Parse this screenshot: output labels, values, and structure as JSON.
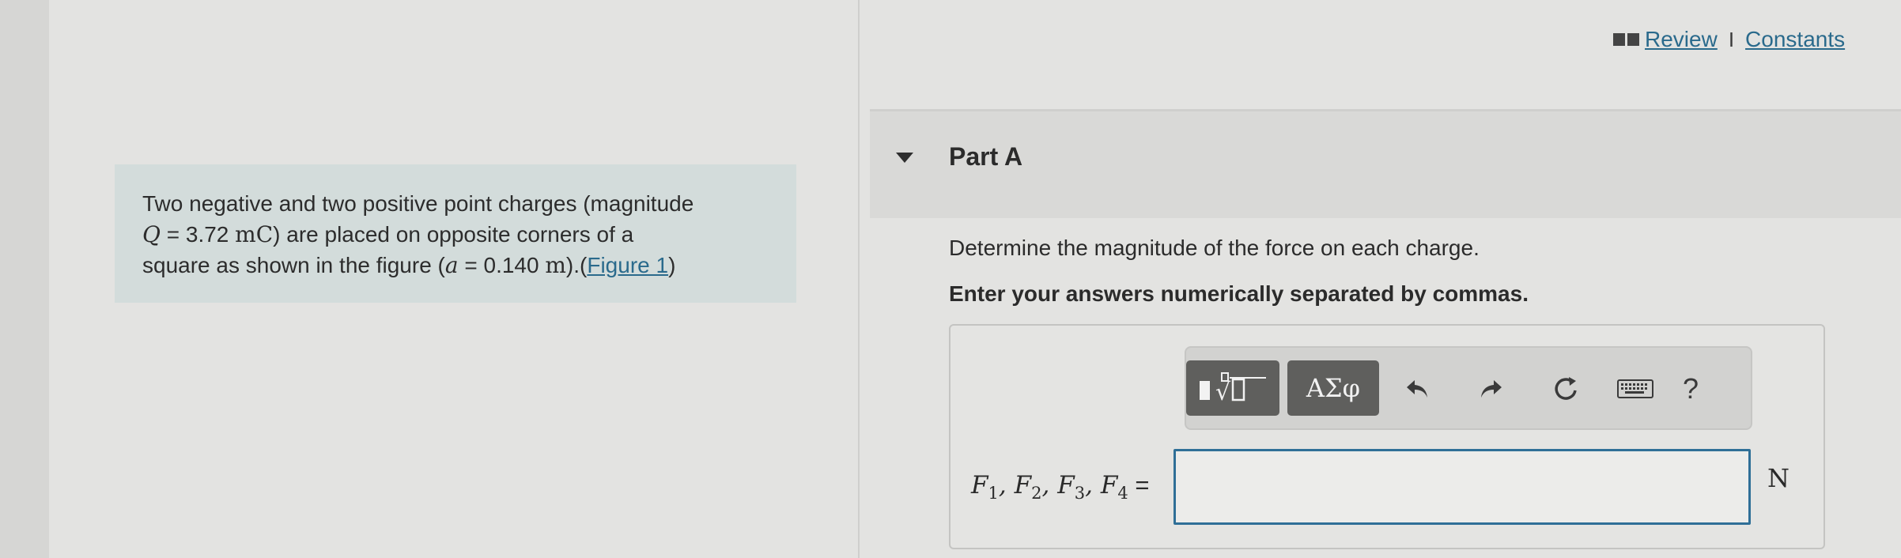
{
  "header": {
    "review_label": "Review",
    "separator": "I",
    "constants_label": "Constants",
    "book_icon": "book-icon"
  },
  "problem": {
    "line1": "Two negative and two positive point charges (magnitude",
    "q_symbol": "Q",
    "q_eq": " = 3.72 ",
    "q_unit": "mC",
    "line2_rest": ") are placed on opposite corners of a",
    "line3_start": "square as shown in the figure (",
    "a_symbol": "a",
    "a_eq": " = 0.140 ",
    "a_unit": "m",
    "line3_end": ").(",
    "figure_link": "Figure 1",
    "close_paren": ")"
  },
  "part": {
    "title": "Part A",
    "caret_icon": "caret-down-icon",
    "question": "Determine the magnitude of the force on each charge.",
    "instruction": "Enter your answers numerically separated by commas."
  },
  "toolbar": {
    "templates_icon": "templates-icon",
    "greek_label": "ΑΣφ",
    "undo_icon": "undo-icon",
    "redo_icon": "redo-icon",
    "reset_icon": "reset-icon",
    "keyboard_icon": "keyboard-icon",
    "help_label": "?"
  },
  "answer": {
    "label_vars": [
      "F",
      "F",
      "F",
      "F"
    ],
    "label_subs": [
      "1",
      "2",
      "3",
      "4"
    ],
    "equals": " =",
    "value": "",
    "unit": "N"
  },
  "colors": {
    "link": "#2a6a8c",
    "input_border": "#2f6f97",
    "problem_bg": "#d3dcdb",
    "toolbar_button": "#5f5f5d"
  }
}
